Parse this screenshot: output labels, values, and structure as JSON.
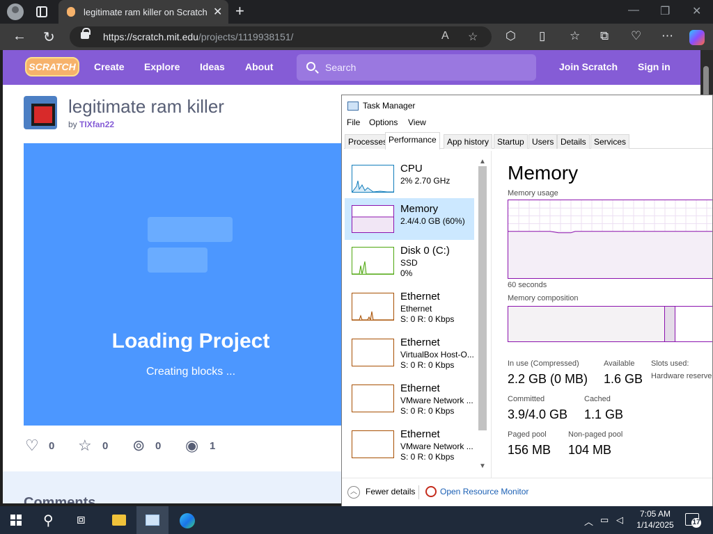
{
  "browser": {
    "tab_title": "legitimate ram killer on Scratch",
    "url_host": "https://scratch.mit.edu",
    "url_path": "/projects/1119938151/",
    "icons": [
      "profile-icon",
      "tab-actions-icon",
      "back-icon",
      "refresh-icon",
      "lock-icon",
      "read-aloud-icon",
      "favorite-star-icon",
      "extensions-icon",
      "split-screen-icon",
      "favorites-icon",
      "collections-icon",
      "browser-essentials-icon",
      "more-icon",
      "copilot-icon"
    ]
  },
  "scratch": {
    "logo": "SCRATCH",
    "nav": {
      "create": "Create",
      "explore": "Explore",
      "ideas": "Ideas",
      "about": "About",
      "join": "Join Scratch",
      "signin": "Sign in"
    },
    "search_placeholder": "Search",
    "project": {
      "title": "legitimate ram killer",
      "by": "by",
      "author": "TIXfan22",
      "loading": "Loading Project",
      "loading_sub": "Creating blocks ..."
    },
    "stats": {
      "loves": "0",
      "favorites": "0",
      "remixes": "0",
      "views": "1"
    },
    "comments_heading": "Comments"
  },
  "task_manager": {
    "title": "Task Manager",
    "menu": [
      "File",
      "Options",
      "View"
    ],
    "tabs": [
      "Processes",
      "Performance",
      "App history",
      "Startup",
      "Users",
      "Details",
      "Services"
    ],
    "active_tab": "Performance",
    "resources": [
      {
        "name": "CPU",
        "line2": "2% 2.70 GHz",
        "line3": "",
        "color": "#117dbb"
      },
      {
        "name": "Memory",
        "line2": "2.4/4.0 GB (60%)",
        "line3": "",
        "color": "#8b12ae"
      },
      {
        "name": "Disk 0 (C:)",
        "line2": "SSD",
        "line3": "0%",
        "color": "#4da60c"
      },
      {
        "name": "Ethernet",
        "line2": "Ethernet",
        "line3": "S: 0 R: 0 Kbps",
        "color": "#a74f01"
      },
      {
        "name": "Ethernet",
        "line2": "VirtualBox Host-O...",
        "line3": "S: 0 R: 0 Kbps",
        "color": "#a74f01"
      },
      {
        "name": "Ethernet",
        "line2": "VMware Network ...",
        "line3": "S: 0 R: 0 Kbps",
        "color": "#a74f01"
      },
      {
        "name": "Ethernet",
        "line2": "VMware Network ...",
        "line3": "S: 0 R: 0 Kbps",
        "color": "#a74f01"
      }
    ],
    "memory": {
      "heading": "Memory",
      "usage_label": "Memory usage",
      "seconds_label": "60 seconds",
      "composition_label": "Memory composition",
      "in_use_label": "In use (Compressed)",
      "in_use": "2.2 GB (0 MB)",
      "available_label": "Available",
      "available": "1.6 GB",
      "slots_label": "Slots used:",
      "hw_reserved_label": "Hardware reserve",
      "committed_label": "Committed",
      "committed": "3.9/4.0 GB",
      "cached_label": "Cached",
      "cached": "1.1 GB",
      "paged_label": "Paged pool",
      "paged": "156 MB",
      "nonpaged_label": "Non-paged pool",
      "nonpaged": "104 MB",
      "usage_fraction": 0.6
    },
    "footer": {
      "fewer": "Fewer details",
      "resmon": "Open Resource Monitor"
    }
  },
  "taskbar": {
    "time": "7:05 AM",
    "date": "1/14/2025",
    "notifications": "17"
  }
}
